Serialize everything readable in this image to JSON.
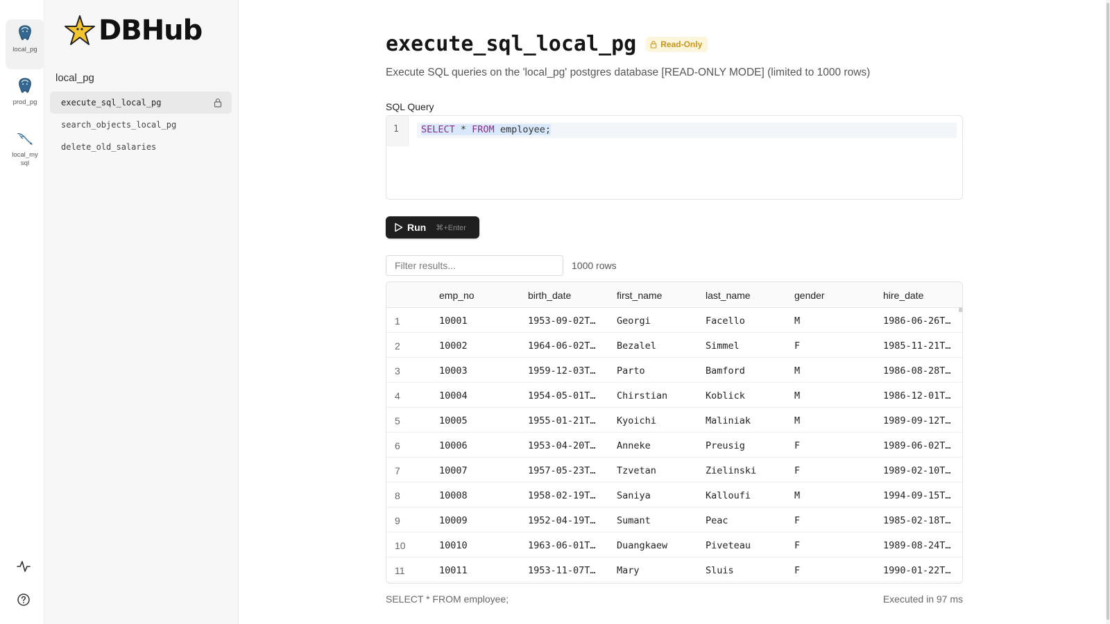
{
  "rail": {
    "connections": [
      {
        "label": "local_pg",
        "icon": "postgres-icon",
        "active": true
      },
      {
        "label": "prod_pg",
        "icon": "postgres-icon",
        "active": false
      },
      {
        "label": "local_mysql",
        "icon": "mysql-icon",
        "active": false
      }
    ],
    "bottom_icons": [
      "activity-icon",
      "help-icon"
    ]
  },
  "sidebar": {
    "brand": "DBHub",
    "section": "local_pg",
    "tools": [
      {
        "label": "execute_sql_local_pg",
        "active": true,
        "locked": true
      },
      {
        "label": "search_objects_local_pg",
        "active": false,
        "locked": false
      },
      {
        "label": "delete_old_salaries",
        "active": false,
        "locked": false
      }
    ]
  },
  "main": {
    "title": "execute_sql_local_pg",
    "badge": "Read-Only",
    "description": "Execute SQL queries on the 'local_pg' postgres database [READ-ONLY MODE] (limited to 1000 rows)",
    "sql_label": "SQL Query",
    "line_number": "1",
    "query": {
      "kw1": "SELECT",
      "mid": " * ",
      "kw2": "FROM",
      "rest": " employee;"
    },
    "run_label": "Run",
    "run_shortcut": "⌘+Enter",
    "filter_placeholder": "Filter results...",
    "row_count": "1000 rows",
    "columns": [
      "emp_no",
      "birth_date",
      "first_name",
      "last_name",
      "gender",
      "hire_date"
    ],
    "rows": [
      [
        "1",
        "10001",
        "1953-09-02T…",
        "Georgi",
        "Facello",
        "M",
        "1986-06-26T…"
      ],
      [
        "2",
        "10002",
        "1964-06-02T…",
        "Bezalel",
        "Simmel",
        "F",
        "1985-11-21T…"
      ],
      [
        "3",
        "10003",
        "1959-12-03T…",
        "Parto",
        "Bamford",
        "M",
        "1986-08-28T…"
      ],
      [
        "4",
        "10004",
        "1954-05-01T…",
        "Chirstian",
        "Koblick",
        "M",
        "1986-12-01T…"
      ],
      [
        "5",
        "10005",
        "1955-01-21T…",
        "Kyoichi",
        "Maliniak",
        "M",
        "1989-09-12T…"
      ],
      [
        "6",
        "10006",
        "1953-04-20T…",
        "Anneke",
        "Preusig",
        "F",
        "1989-06-02T…"
      ],
      [
        "7",
        "10007",
        "1957-05-23T…",
        "Tzvetan",
        "Zielinski",
        "F",
        "1989-02-10T…"
      ],
      [
        "8",
        "10008",
        "1958-02-19T…",
        "Saniya",
        "Kalloufi",
        "M",
        "1994-09-15T…"
      ],
      [
        "9",
        "10009",
        "1952-04-19T…",
        "Sumant",
        "Peac",
        "F",
        "1985-02-18T…"
      ],
      [
        "10",
        "10010",
        "1963-06-01T…",
        "Duangkaew",
        "Piveteau",
        "F",
        "1989-08-24T…"
      ],
      [
        "11",
        "10011",
        "1953-11-07T…",
        "Mary",
        "Sluis",
        "F",
        "1990-01-22T…"
      ]
    ],
    "footer_sql": "SELECT * FROM employee;",
    "footer_time": "Executed in 97 ms"
  },
  "colors": {
    "accent_badge_bg": "#fdf6dc",
    "accent_badge_text": "#c9951b",
    "keyword": "#8a2b91",
    "run_bg": "#1f1f1f"
  }
}
